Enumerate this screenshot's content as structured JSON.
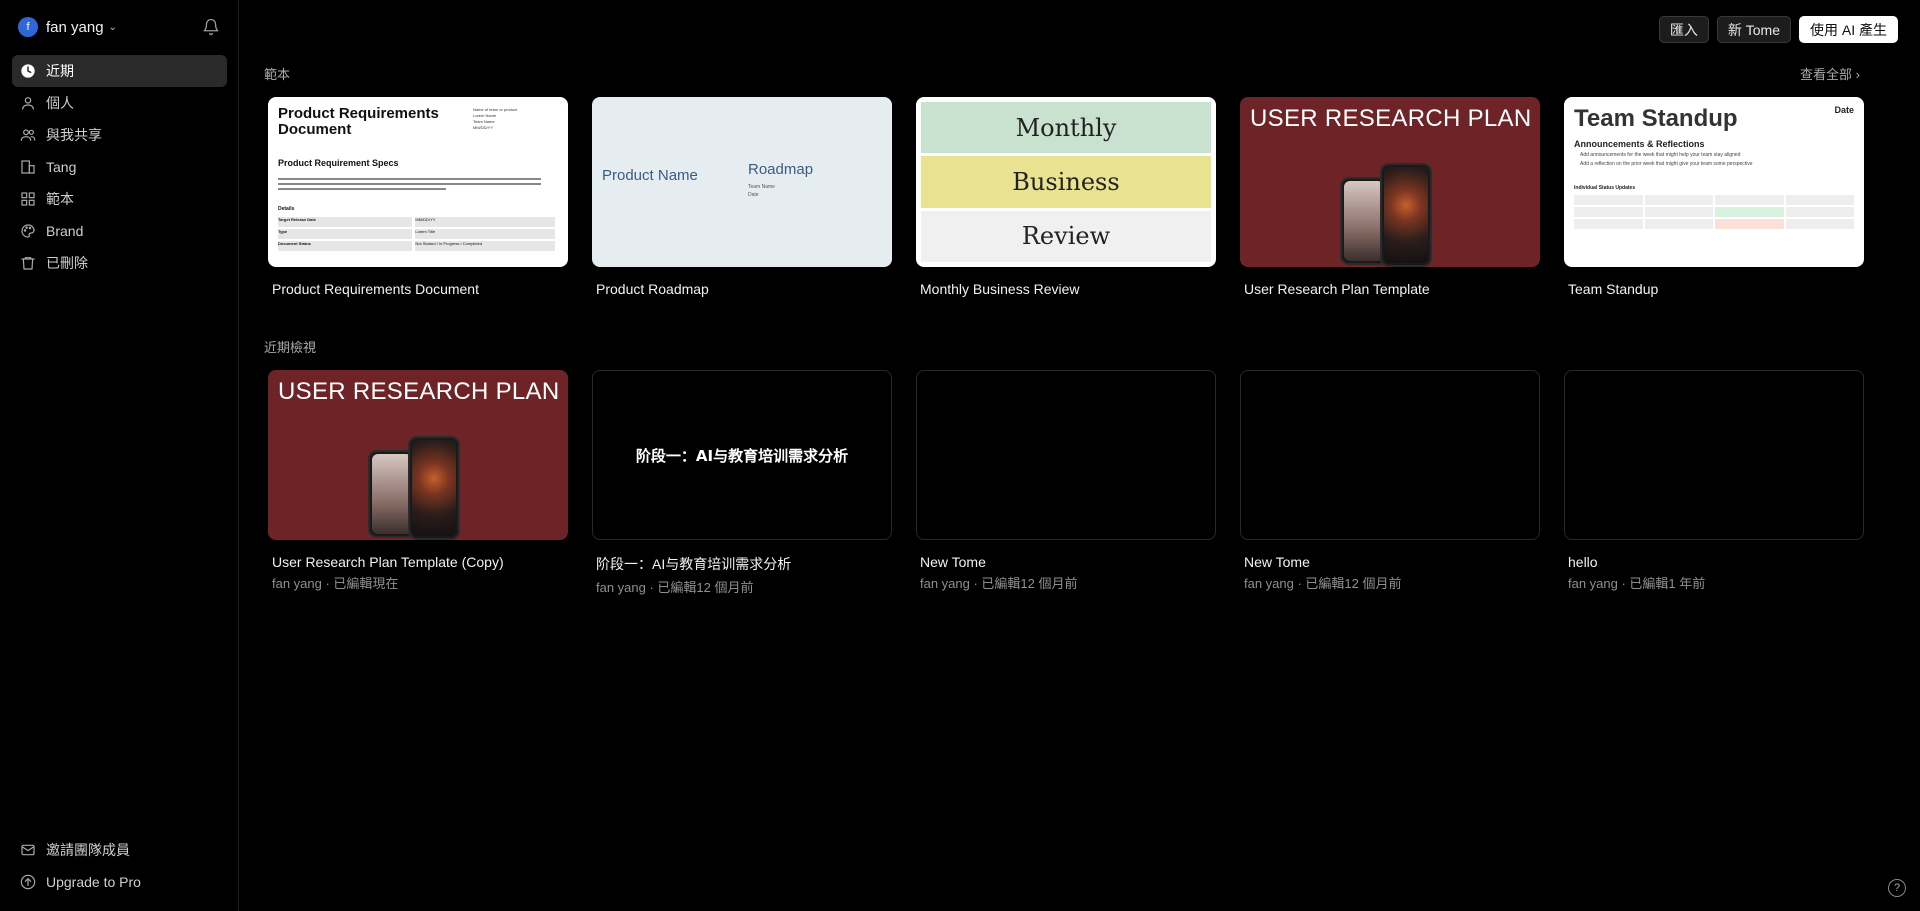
{
  "user": {
    "initial": "f",
    "name": "fan yang"
  },
  "nav": [
    {
      "label": "近期",
      "icon": "clock-icon",
      "active": true
    },
    {
      "label": "個人",
      "icon": "user-icon"
    },
    {
      "label": "與我共享",
      "icon": "users-icon"
    },
    {
      "label": "Tang",
      "icon": "building-icon"
    },
    {
      "label": "範本",
      "icon": "grid-icon"
    },
    {
      "label": "Brand",
      "icon": "palette-icon"
    },
    {
      "label": "已刪除",
      "icon": "trash-icon"
    }
  ],
  "bottom_nav": [
    {
      "label": "邀請團隊成員",
      "icon": "mail-icon"
    },
    {
      "label": "Upgrade to Pro",
      "icon": "arrow-up-circle-icon"
    }
  ],
  "toolbar": {
    "import_label": "匯入",
    "new_tome_label": "新 Tome",
    "ai_label": "使用 AI 產生"
  },
  "templates_section": {
    "label": "範本",
    "see_all": "查看全部 ›"
  },
  "templates": [
    {
      "title": "Product Requirements Document",
      "thumb_heading": "Product Requirements Document",
      "thumb_meta": [
        "Name of team or product",
        "Lorem Name",
        "Team Name",
        "MM/DD/YY"
      ],
      "thumb_subheading": "Product Requirement Specs",
      "thumb_details": "Details",
      "thumb_rows": [
        [
          "Target Release Date",
          "MM/DD/YY"
        ],
        [
          "Type",
          "Lorem Title"
        ],
        [
          "Document Status",
          "Not Started / In Progress / Completed"
        ]
      ]
    },
    {
      "title": "Product Roadmap",
      "thumb_left": "Product Name",
      "thumb_right": "Roadmap",
      "thumb_small": [
        "Team Name",
        "Date"
      ]
    },
    {
      "title": "Monthly Business Review",
      "thumb_lines": [
        "Monthly",
        "Business",
        "Review"
      ]
    },
    {
      "title": "User Research Plan Template",
      "thumb_heading": "USER RESEARCH PLAN"
    },
    {
      "title": "Team Standup",
      "thumb_heading": "Team Standup",
      "thumb_date": "Date",
      "thumb_subheading": "Announcements & Reflections",
      "thumb_bullets": [
        "Add announcements for the week that might help your team stay aligned",
        "Add a reflection on the prior week that might give your team some perspective"
      ],
      "thumb_table_title": "Individual Status Updates"
    }
  ],
  "recent_section": {
    "label": "近期檢視"
  },
  "recent": [
    {
      "title": "User Research Plan Template (Copy)",
      "subtitle": "fan yang · 已編輯現在",
      "thumb_heading": "USER RESEARCH PLAN"
    },
    {
      "title": "阶段一：AI与教育培训需求分析",
      "subtitle": "fan yang · 已編輯12 個月前",
      "thumb_text": "阶段一：AI与教育培训需求分析"
    },
    {
      "title": "New Tome",
      "subtitle": "fan yang · 已編輯12 個月前"
    },
    {
      "title": "New Tome",
      "subtitle": "fan yang · 已編輯12 個月前"
    },
    {
      "title": "hello",
      "subtitle": "fan yang · 已編輯1 年前"
    }
  ],
  "help": {
    "label": "?"
  }
}
